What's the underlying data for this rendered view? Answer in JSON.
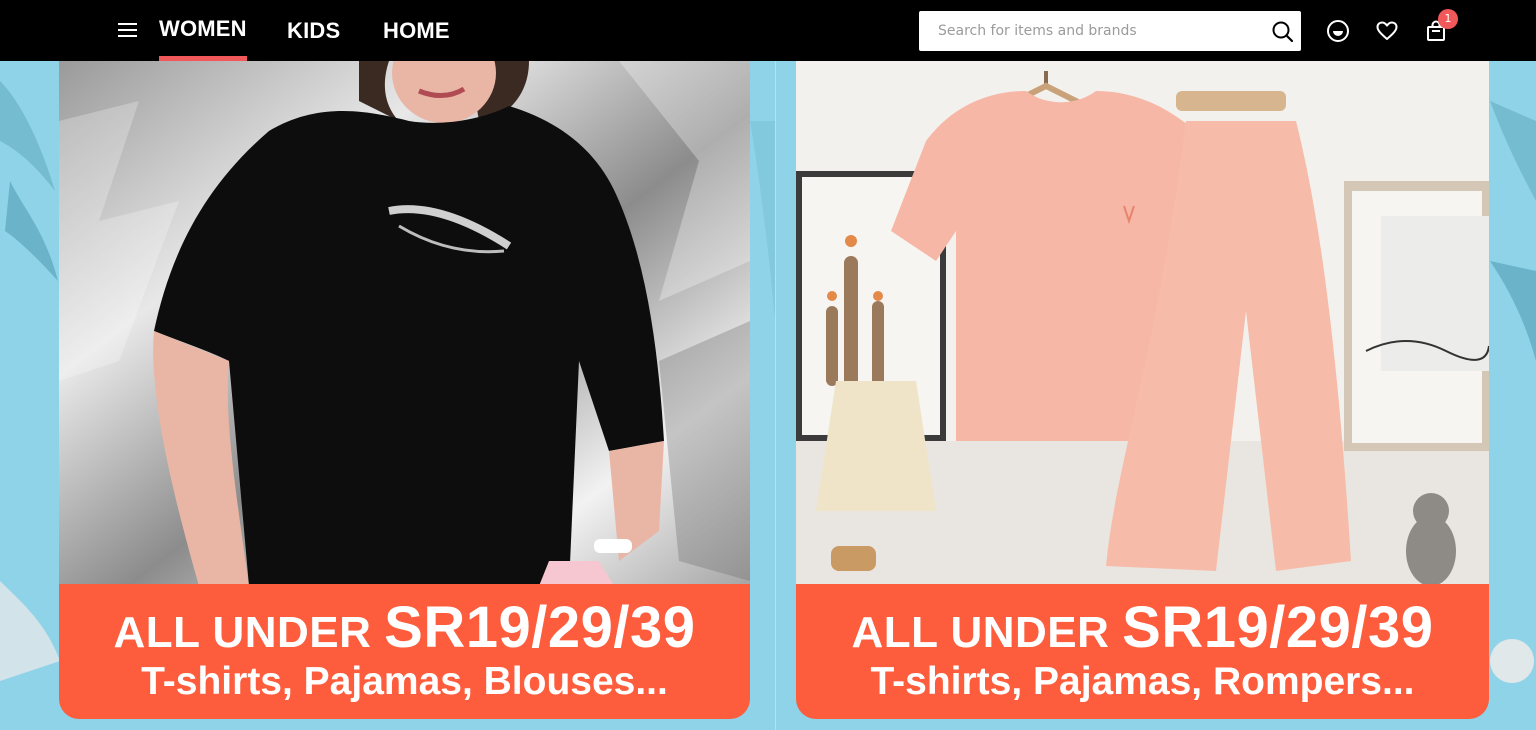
{
  "header": {
    "menu_icon": "hamburger-icon",
    "tabs": [
      {
        "label": "WOMEN",
        "active": true
      },
      {
        "label": "KIDS",
        "active": false
      },
      {
        "label": "HOME",
        "active": false
      }
    ],
    "search": {
      "placeholder": "Search for items and brands",
      "value": "",
      "icon": "search-icon"
    },
    "icons": [
      "account-icon",
      "heart-icon",
      "shopping-bag-icon"
    ],
    "cart_count": "1",
    "accent_color": "#f0585a"
  },
  "banners": [
    {
      "promo_lead": "ALL UNDER ",
      "promo_price": "SR19/29/39",
      "promo_subtitle": "T-shirts, Pajamas, Blouses...",
      "promo_color": "#fd5d3c"
    },
    {
      "promo_lead": "ALL UNDER ",
      "promo_price": "SR19/29/39",
      "promo_subtitle": "T-shirts, Pajamas, Rompers...",
      "promo_color": "#fd5d3c"
    }
  ],
  "page_background": "#8fd3e8"
}
